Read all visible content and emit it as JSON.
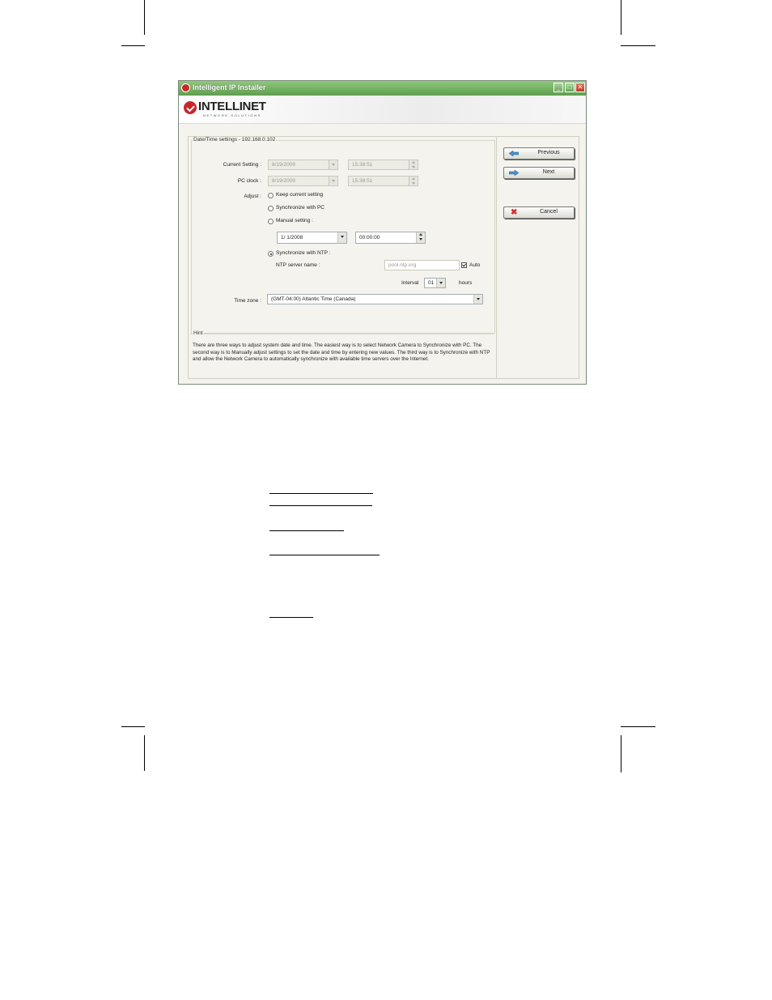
{
  "window": {
    "title": "Intelligent IP Installer",
    "minimize": "_",
    "maximize": "□",
    "close": "✕"
  },
  "logo": {
    "brand": "INTELLINET",
    "tagline": "NETWORK SOLUTIONS"
  },
  "datetime": {
    "group_title": "Date/Time settings - 192.168.0.102",
    "current_setting_label": "Current Setting :",
    "current_date": "8/19/2009",
    "current_time": "15:38:51",
    "pc_clock_label": "PC clock :",
    "pc_date": "8/19/2009",
    "pc_time": "15:38:51",
    "adjust_label": "Adjust :",
    "option_keep": "Keep current setting",
    "option_sync_pc": "Synchronize with PC",
    "option_manual": "Manual setting :",
    "manual_date": "1/ 1/2008",
    "manual_time": "00:00:00",
    "option_ntp": "Synchronize with NTP :",
    "selected_option": "ntp",
    "ntp_server_label": "NTP server name :",
    "ntp_server_value": "pool.ntp.org",
    "auto_label": "Auto",
    "auto_checked": true,
    "interval_label": "Interval",
    "interval_value": "01",
    "hours_label": "hours",
    "timezone_label": "Time zone :",
    "timezone_value": "(GMT-04:00) Atlantic Time (Canada)"
  },
  "hint": {
    "title": "Hint",
    "text": "There are three ways to adjust system date and time. The easiest way is to select Network Camera to Synchronize with PC. The second way is to Manually adjust settings to set the date and time by entering new values. The third way is to Synchronize with NTP and allow the Network Camera to automatically synchronize with available time servers over the Internet."
  },
  "buttons": {
    "previous": "Previous",
    "next": "Next",
    "cancel": "Cancel"
  },
  "colors": {
    "titlebar": "#6aa35a",
    "accent_red": "#c62828",
    "arrow_blue": "#4a90c8"
  }
}
